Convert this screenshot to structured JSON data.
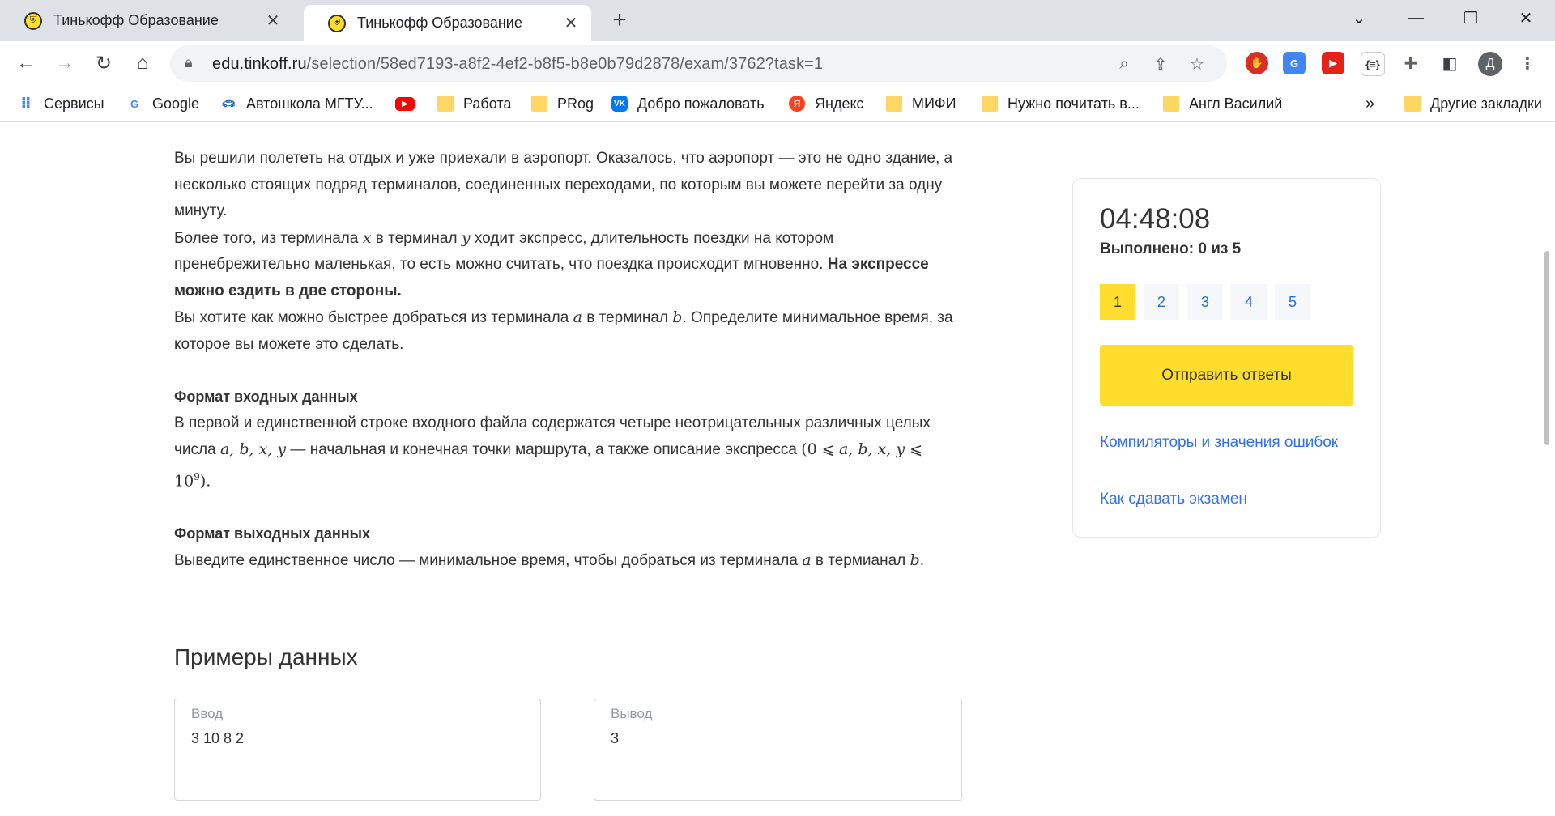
{
  "tabs": [
    {
      "title": "Тинькофф Образование",
      "active": false
    },
    {
      "title": "Тинькофф Образование",
      "active": true
    }
  ],
  "address": {
    "domain": "edu.tinkoff.ru",
    "path": "/selection/58ed7193-a8f2-4ef2-b8f5-b8e0b79d2878/exam/3762?task=1"
  },
  "bookmarks": [
    {
      "label": "Сервисы",
      "icon": "apps-grid-icon"
    },
    {
      "label": "Google",
      "icon": "google-icon"
    },
    {
      "label": "Автошкола МГТУ...",
      "icon": "car-icon"
    },
    {
      "label": "",
      "icon": "youtube-icon"
    },
    {
      "label": "Работа",
      "icon": "folder-icon"
    },
    {
      "label": "PRog",
      "icon": "folder-icon"
    },
    {
      "label": "Добро пожаловать",
      "icon": "vk-icon"
    },
    {
      "label": "Яндекс",
      "icon": "yandex-icon"
    },
    {
      "label": "МИФИ",
      "icon": "folder-icon"
    },
    {
      "label": "Нужно почитать в...",
      "icon": "folder-icon"
    },
    {
      "label": "Англ Василий",
      "icon": "folder-icon"
    },
    {
      "label": "Другие закладки",
      "icon": "folder-icon"
    }
  ],
  "profile_initial": "Д",
  "problem": {
    "s1": "Вы решили полететь на отдых и уже приехали в аэропорт. Оказалось, что аэропорт — это не одно здание, а несколько стоящих подряд терминалов, соединенных переходами, по которым вы можете перейти за одну минуту.",
    "s2a": "Более того, из терминала ",
    "var_x": "x",
    "s2b": " в терминал ",
    "var_y": "y",
    "s2c": " ходит экспресс, длительность поездки на котором пренебрежительно маленькая, то есть можно считать, что поездка происходит мгновенно. ",
    "s2bold": "На экспрессе можно ездить в две стороны.",
    "s3a": "Вы хотите как можно быстрее добраться из терминала ",
    "var_a": "a",
    "s3b": " в терминал ",
    "var_b": "b",
    "s3c": ". Определите минимальное время, за которое вы можете это сделать.",
    "input_heading": "Формат входных данных",
    "input_a": "В первой и единственной строке входного файла содержатся четыре неотрицательных различных целых числа ",
    "input_vars": "a, b, x, y",
    "input_b": " — начальная и конечная точки маршрута, а также описание экспресса ",
    "input_constraint_open": "(0 ⩽",
    "input_constraint_vars": "a, b, x, y",
    "input_constraint_le": " ⩽ 10",
    "input_constraint_exp": "9",
    "input_constraint_close": ").",
    "output_heading": "Формат выходных данных",
    "output_a": "Выведите единственное число — минимальное время, чтобы добраться из терминала ",
    "output_var_a": "a",
    "output_b": " в термианал ",
    "output_var_b": "b",
    "output_c": "."
  },
  "examples": {
    "title": "Примеры данных",
    "input_label": "Ввод",
    "input_value": "3 10 8 2",
    "output_label": "Вывод",
    "output_value": "3"
  },
  "sidebar": {
    "timer": "04:48:08",
    "progress": "Выполнено: 0 из 5",
    "tasks": [
      "1",
      "2",
      "3",
      "4",
      "5"
    ],
    "active_task": "1",
    "submit": "Отправить ответы",
    "link1": "Компиляторы и значения ошибок",
    "link2": "Как сдавать экзамен"
  },
  "colors": {
    "accent": "#ffdd2d",
    "link": "#336fee"
  }
}
